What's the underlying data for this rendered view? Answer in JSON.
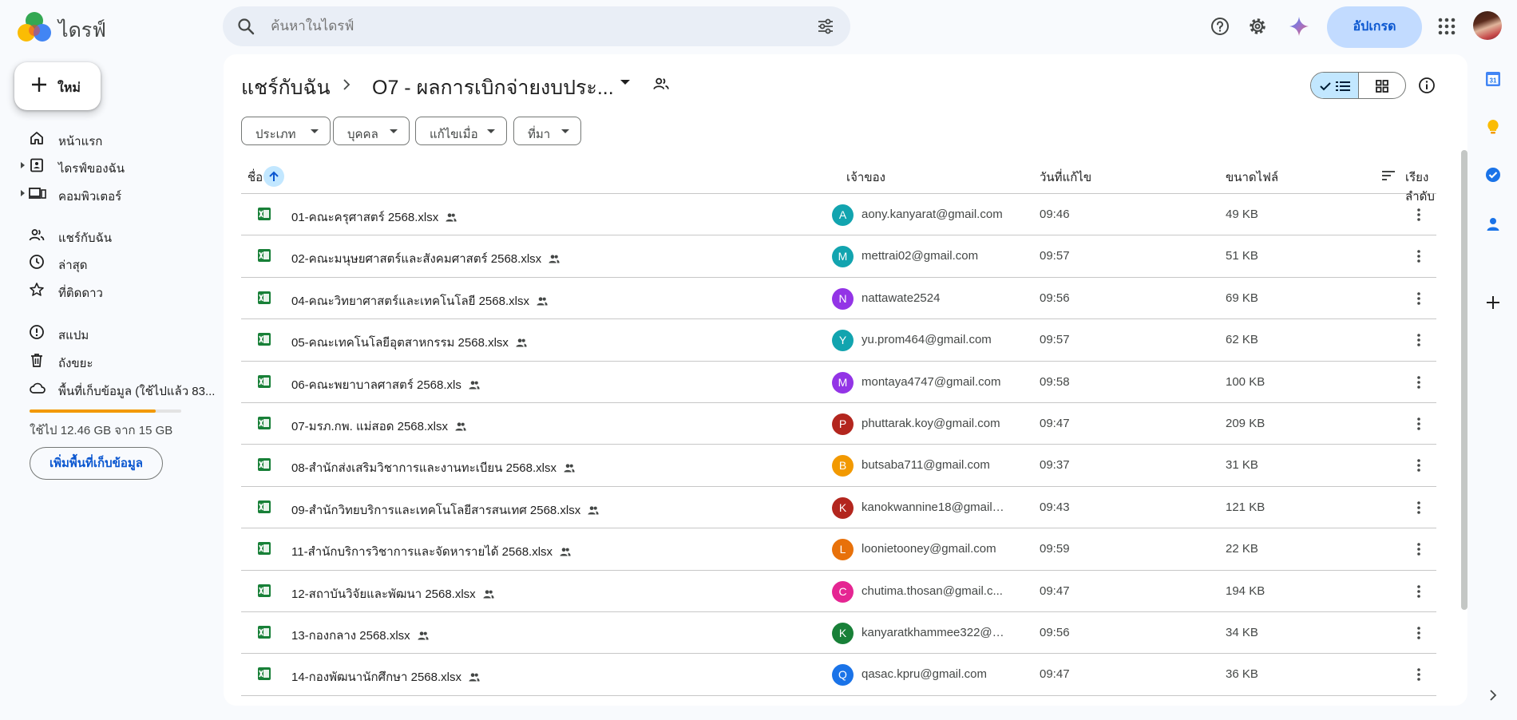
{
  "app": {
    "title": "ไดรฟ์"
  },
  "search": {
    "placeholder": "ค้นหาในไดรฟ์"
  },
  "topbar": {
    "upgrade_label": "อัปเกรด"
  },
  "nav": {
    "new_label": "ใหม่",
    "items": [
      {
        "label": "หน้าแรก",
        "icon": "home-icon"
      },
      {
        "label": "ไดรฟ์ของฉัน",
        "icon": "my-drive-icon"
      },
      {
        "label": "คอมพิวเตอร์",
        "icon": "computer-icon"
      },
      {
        "label": "แชร์กับฉัน",
        "icon": "shared-icon"
      },
      {
        "label": "ล่าสุด",
        "icon": "clock-icon"
      },
      {
        "label": "ที่ติดดาว",
        "icon": "star-icon"
      },
      {
        "label": "สแปม",
        "icon": "spam-icon"
      },
      {
        "label": "ถังขยะ",
        "icon": "trash-icon"
      },
      {
        "label": "พื้นที่เก็บข้อมูล (ใช้ไปแล้ว 83...",
        "icon": "cloud-icon"
      }
    ],
    "storage_used_fraction": 0.83,
    "storage_text": "ใช้ไป 12.46 GB จาก 15 GB",
    "get_more_storage": "เพิ่มพื้นที่เก็บข้อมูล"
  },
  "breadcrumb": {
    "root": "แชร์กับฉัน",
    "current": "O7 - ผลการเบิกจ่ายงบประ..."
  },
  "filters": [
    "ประเภท",
    "บุคคล",
    "แก้ไขเมื่อ",
    "ที่มา"
  ],
  "table": {
    "headers": {
      "name": "ชื่อ",
      "owner": "เจ้าของ",
      "modified": "วันที่แก้ไข",
      "size": "ขนาดไฟล์",
      "sort": "เรียงลำดับ"
    },
    "rows": [
      {
        "name": "01-คณะครุศาสตร์ 2568.xlsx",
        "initial": "A",
        "color": "#12a4af",
        "owner": "aony.kanyarat@gmail.com",
        "modified": "09:46",
        "size": "49 KB"
      },
      {
        "name": "02-คณะมนุษยศาสตร์และสังคมศาสตร์ 2568.xlsx",
        "initial": "M",
        "color": "#12a4af",
        "owner": "mettrai02@gmail.com",
        "modified": "09:57",
        "size": "51 KB"
      },
      {
        "name": "04-คณะวิทยาศาสตร์และเทคโนโลยี 2568.xlsx",
        "initial": "N",
        "color": "#9334e6",
        "owner": "nattawate2524",
        "modified": "09:56",
        "size": "69 KB"
      },
      {
        "name": "05-คณะเทคโนโลยีอุตสาหกรรม 2568.xlsx",
        "initial": "Y",
        "color": "#12a4af",
        "owner": "yu.prom464@gmail.com",
        "modified": "09:57",
        "size": "62 KB"
      },
      {
        "name": "06-คณะพยาบาลศาสตร์ 2568.xls",
        "initial": "M",
        "color": "#9334e6",
        "owner": "montaya4747@gmail.com",
        "modified": "09:58",
        "size": "100 KB"
      },
      {
        "name": "07-มรภ.กพ. แม่สอด 2568.xlsx",
        "initial": "P",
        "color": "#b3261e",
        "owner": "phuttarak.koy@gmail.com",
        "modified": "09:47",
        "size": "209 KB"
      },
      {
        "name": "08-สำนักส่งเสริมวิชาการและงานทะเบียน 2568.xlsx",
        "initial": "B",
        "color": "#f29900",
        "owner": "butsaba711@gmail.com",
        "modified": "09:37",
        "size": "31 KB"
      },
      {
        "name": "09-สำนักวิทยบริการและเทคโนโลยีสารสนเทศ 2568.xlsx",
        "initial": "K",
        "color": "#b3261e",
        "owner": "kanokwannine18@gmail....",
        "modified": "09:43",
        "size": "121 KB"
      },
      {
        "name": "11-สำนักบริการวิชาการและจัดหารายได้ 2568.xlsx",
        "initial": "L",
        "color": "#e8710a",
        "owner": "loonietooney@gmail.com",
        "modified": "09:59",
        "size": "22 KB"
      },
      {
        "name": "12-สถาบันวิจัยและพัฒนา 2568.xlsx",
        "initial": "C",
        "color": "#e52592",
        "owner": "chutima.thosan@gmail.c...",
        "modified": "09:47",
        "size": "194 KB"
      },
      {
        "name": "13-กองกลาง 2568.xlsx",
        "initial": "K",
        "color": "#188038",
        "owner": "kanyaratkhammee322@g...",
        "modified": "09:56",
        "size": "34 KB"
      },
      {
        "name": "14-กองพัฒนานักศึกษา 2568.xlsx",
        "initial": "Q",
        "color": "#1a73e8",
        "owner": "qasac.kpru@gmail.com",
        "modified": "09:47",
        "size": "36 KB"
      }
    ]
  },
  "rail": {
    "calendar_date": "31"
  }
}
